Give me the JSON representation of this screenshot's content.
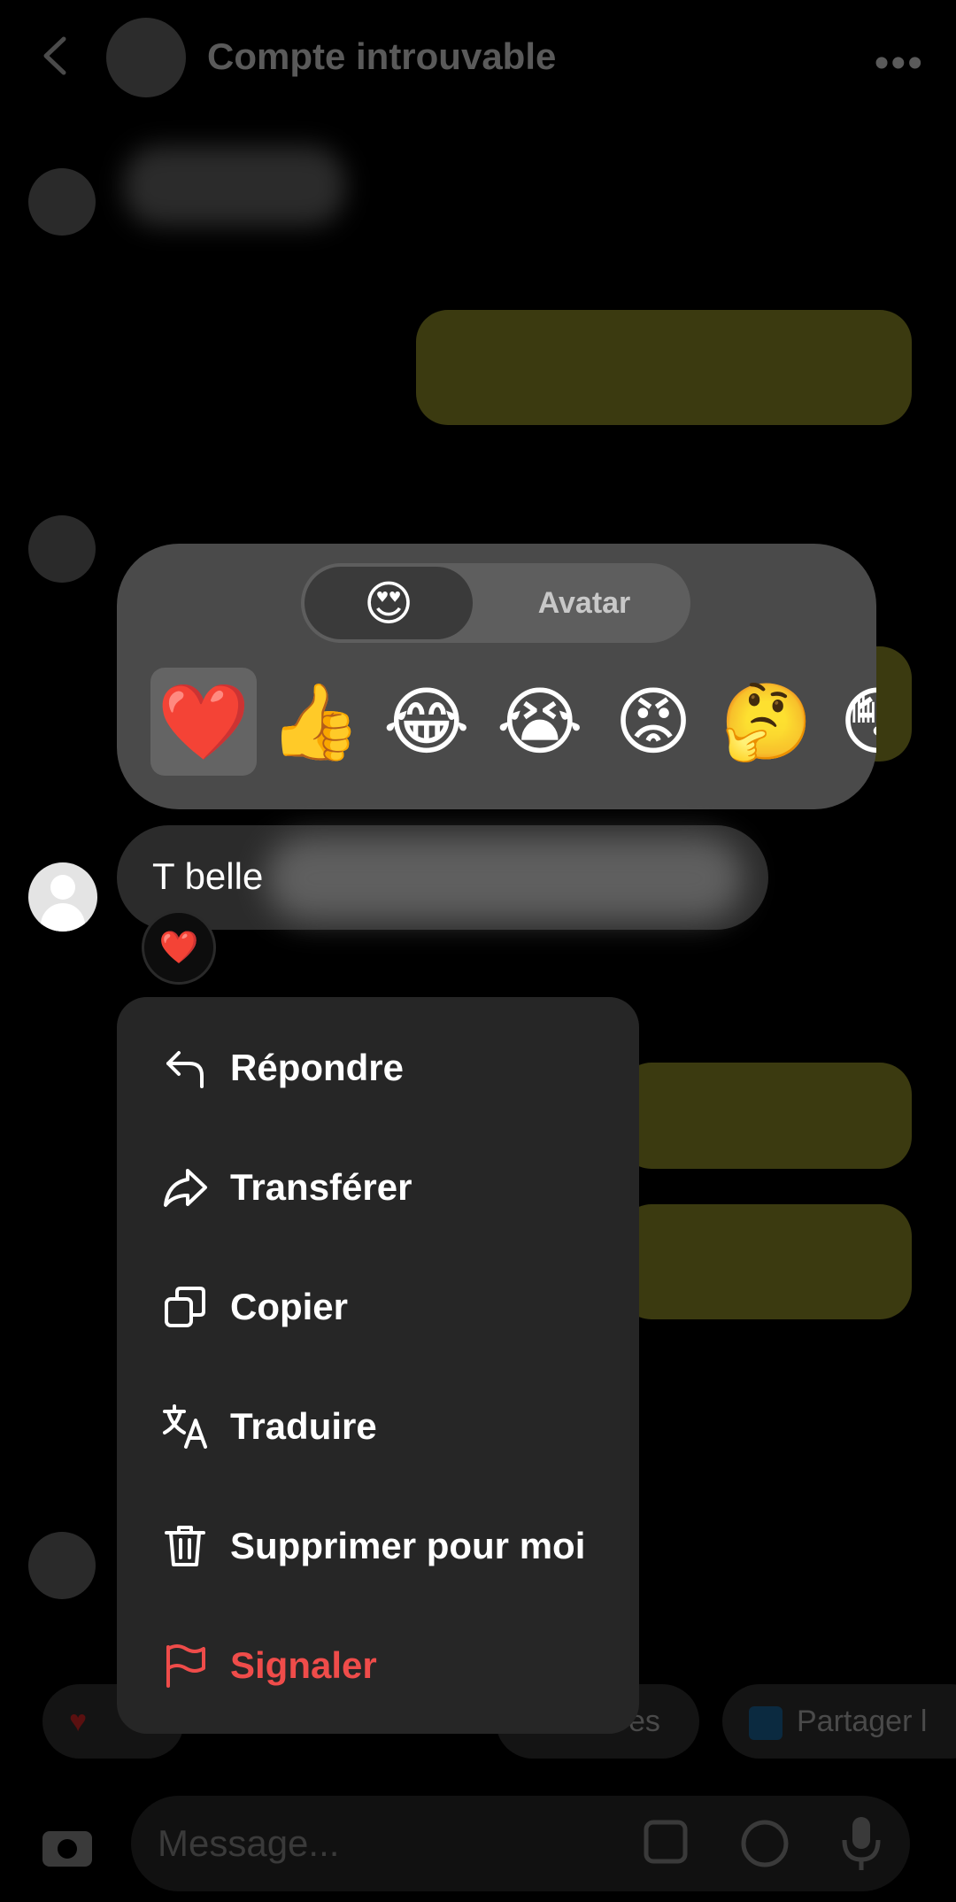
{
  "header": {
    "title": "Compte introuvable"
  },
  "reaction_picker": {
    "tab_emoji": "😍",
    "tab_avatar": "Avatar",
    "emojis": [
      "❤️",
      "👍",
      "😂",
      "😭",
      "😡",
      "🤔",
      "😳"
    ],
    "selected_index": 0
  },
  "message": {
    "text": "T belle",
    "reaction": "❤️"
  },
  "context_menu": {
    "items": [
      {
        "label": "Répondre",
        "icon": "reply-icon"
      },
      {
        "label": "Transférer",
        "icon": "forward-icon"
      },
      {
        "label": "Copier",
        "icon": "copy-icon"
      },
      {
        "label": "Traduire",
        "icon": "translate-icon"
      },
      {
        "label": "Supprimer pour moi",
        "icon": "trash-icon"
      },
      {
        "label": "Signaler",
        "icon": "flag-icon",
        "color": "#ef4c4a"
      }
    ]
  },
  "background": {
    "share_chip": "Partager l",
    "stickers_chip_fragment": "es",
    "composer_placeholder": "Message..."
  },
  "colors": {
    "menu_bg": "#262626",
    "panel_bg": "#4a4a4a",
    "danger": "#ef4c4a"
  }
}
